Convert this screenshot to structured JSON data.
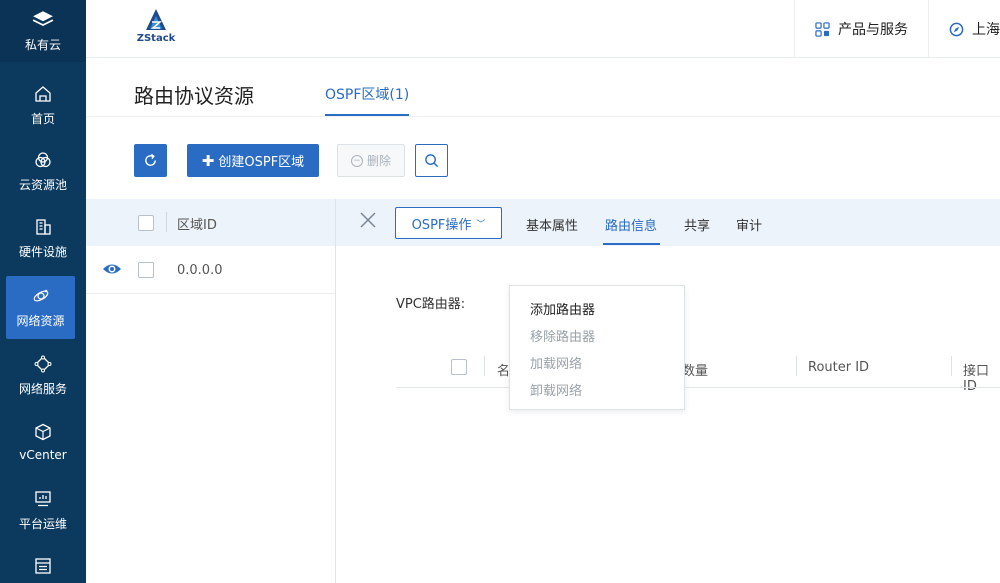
{
  "sidebar": {
    "brand": "私有云",
    "items": [
      {
        "label": "首页",
        "icon": "home-icon"
      },
      {
        "label": "云资源池",
        "icon": "cloud-pool-icon"
      },
      {
        "label": "硬件设施",
        "icon": "building-icon"
      },
      {
        "label": "网络资源",
        "icon": "network-resource-icon",
        "active": true
      },
      {
        "label": "网络服务",
        "icon": "network-service-icon"
      },
      {
        "label": "vCenter",
        "icon": "cube-icon"
      },
      {
        "label": "平台运维",
        "icon": "monitor-icon"
      },
      {
        "label": "",
        "icon": "list-icon"
      }
    ]
  },
  "topbar": {
    "logo_text": "ZStack",
    "products_label": "产品与服务",
    "region_label": "上海"
  },
  "page": {
    "title": "路由协议资源",
    "tab_label": "OSPF区域(1)"
  },
  "toolbar": {
    "create_label": "创建OSPF区域",
    "delete_label": "删除"
  },
  "table": {
    "column_area_id": "区域ID",
    "rows": [
      {
        "area_id": "0.0.0.0"
      }
    ]
  },
  "detail": {
    "action_label": "OSPF操作",
    "tabs": [
      "基本属性",
      "路由信息",
      "共享",
      "审计"
    ],
    "active_tab": "路由信息",
    "vpc_label": "VPC路由器:",
    "sub_columns": [
      "名",
      "数量",
      "Router ID",
      "接口ID"
    ]
  },
  "menu": {
    "items": [
      {
        "label": "添加路由器",
        "enabled": true
      },
      {
        "label": "移除路由器",
        "enabled": false
      },
      {
        "label": "加载网络",
        "enabled": false
      },
      {
        "label": "卸载网络",
        "enabled": false
      }
    ]
  },
  "colors": {
    "sidebar_bg": "#0c3a5f",
    "accent": "#2a6cc4",
    "header_bg": "#edf3fb"
  }
}
